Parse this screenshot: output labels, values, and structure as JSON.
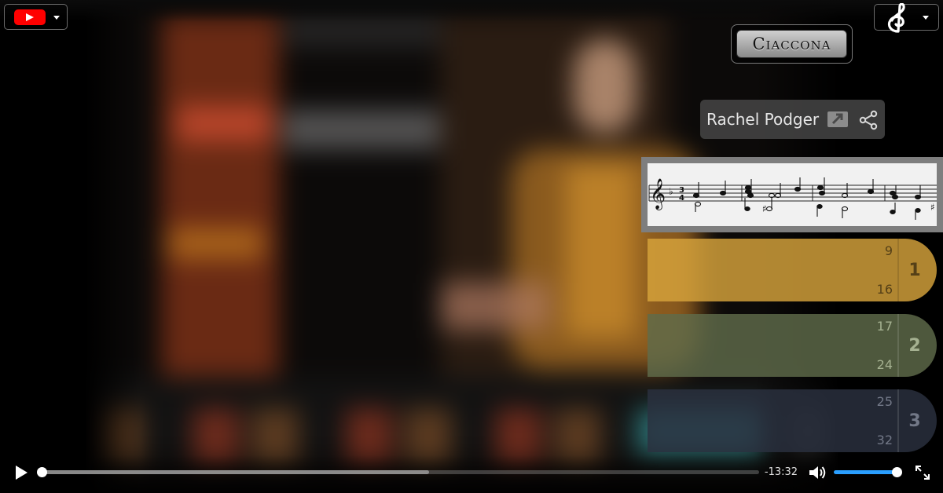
{
  "player": {
    "brand_icon": "youtube-logo-icon",
    "menu_icon": "treble-clef-icon",
    "work_title": "Ciaccona",
    "artist": {
      "name": "Rachel Podger",
      "open_icon": "external-link-icon",
      "share_icon": "share-icon"
    },
    "score_excerpt_icon": "sheet-music-excerpt",
    "sections": [
      {
        "number": "1",
        "bar_start": "9",
        "bar_end": "16",
        "color": "#d7a43c"
      },
      {
        "number": "2",
        "bar_start": "17",
        "bar_end": "24",
        "color": "#5f6b4a"
      },
      {
        "number": "3",
        "bar_start": "25",
        "bar_end": "32",
        "color": "#2b3140"
      }
    ],
    "controls": {
      "play_icon": "play-icon",
      "time_remaining": "-13:32",
      "progress": 0.0,
      "buffered": 0.54,
      "volume": 0.97,
      "volume_icon": "volume-icon",
      "fullscreen_icon": "fullscreen-icon"
    }
  }
}
